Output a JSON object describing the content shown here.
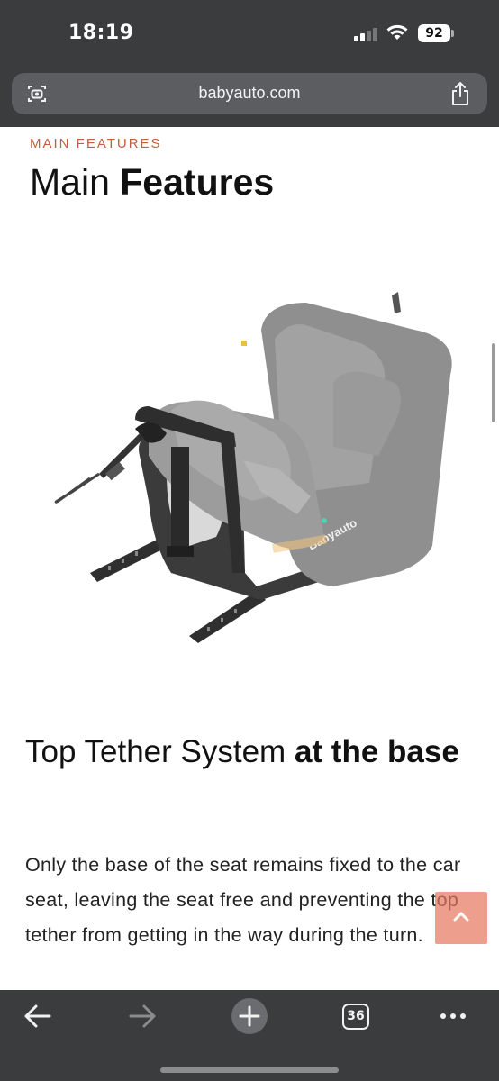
{
  "status_bar": {
    "time": "18:19",
    "battery": "92",
    "icons": [
      "signal-icon",
      "wifi-icon",
      "battery-icon"
    ]
  },
  "browser": {
    "url": "babyauto.com",
    "left_icon": "page-tools-icon",
    "right_icon": "share-icon"
  },
  "page": {
    "eyebrow": "MAIN FEATURES",
    "title_light": "Main ",
    "title_bold": "Features",
    "image_alt": "Babyauto car seat with top tether base",
    "section_title_light": "Top Tether System ",
    "section_title_bold": "at the base",
    "body": "Only the base of the seat remains fixed to the car seat, leaving the seat free and preventing the top tether from getting in the way during the turn.",
    "back_to_top_icon": "chevron-up-icon",
    "seat_brand": "Babyauto"
  },
  "toolbar": {
    "back_icon": "back-arrow-icon",
    "forward_icon": "forward-arrow-icon",
    "new_tab_icon": "plus-icon",
    "tab_count": "36",
    "more_icon": "more-icon"
  },
  "colors": {
    "chrome": "#3a3c3e",
    "url_bar": "#5b5d60",
    "eyebrow": "#c4603f",
    "back_to_top": "#e8785f"
  }
}
